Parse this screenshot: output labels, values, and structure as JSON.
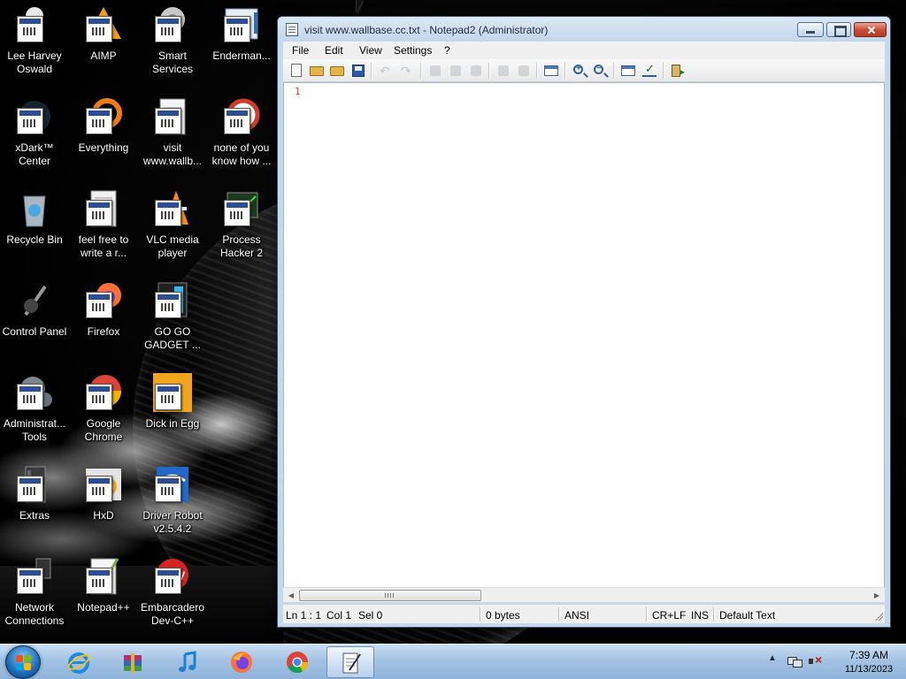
{
  "desktop": {
    "icons": [
      {
        "label": "Lee Harvey\nOswald"
      },
      {
        "label": "AIMP"
      },
      {
        "label": "Smart\nServices"
      },
      {
        "label": "Enderman..."
      },
      {
        "label": "xDark™\nCenter"
      },
      {
        "label": "Everything"
      },
      {
        "label": "visit\nwww.wallb..."
      },
      {
        "label": "none of you\nknow how ..."
      },
      {
        "label": "Recycle Bin"
      },
      {
        "label": "feel free to\nwrite a r..."
      },
      {
        "label": "VLC media\nplayer"
      },
      {
        "label": "Process\nHacker 2"
      },
      {
        "label": "Control Panel"
      },
      {
        "label": "Firefox"
      },
      {
        "label": "GO GO\nGADGET ..."
      },
      {
        "label": "Administrat...\nTools"
      },
      {
        "label": "Google\nChrome"
      },
      {
        "label": "Dick in Egg"
      },
      {
        "label": "Extras"
      },
      {
        "label": "HxD"
      },
      {
        "label": "Driver Robot\nv2.5.4.2"
      },
      {
        "label": "Network\nConnections"
      },
      {
        "label": "Notepad++"
      },
      {
        "label": "Embarcadero\nDev-C++"
      }
    ]
  },
  "window": {
    "title": "visit www.wallbase.cc.txt - Notepad2 (Administrator)",
    "menu": [
      "File",
      "Edit",
      "View",
      "Settings",
      "?"
    ],
    "editor": {
      "line_number": "1",
      "content": ""
    },
    "status": {
      "position": "Ln 1 : 1",
      "column": "Col 1",
      "selection": "Sel 0",
      "size": "0 bytes",
      "encoding": "ANSI",
      "line_endings": "CR+LF",
      "mode": "INS",
      "scheme": "Default Text"
    }
  },
  "taskbar": {
    "pinned": [
      "Internet Explorer",
      "WinRAR",
      "iTunes",
      "Firefox",
      "Google Chrome",
      "Notepad2"
    ],
    "clock": {
      "time": "7:39 AM",
      "date": "11/13/2023"
    }
  },
  "colors": {
    "line_number": "#d84040",
    "titlebar": "#c4d6ec",
    "taskbar": "#a4c3e3"
  }
}
